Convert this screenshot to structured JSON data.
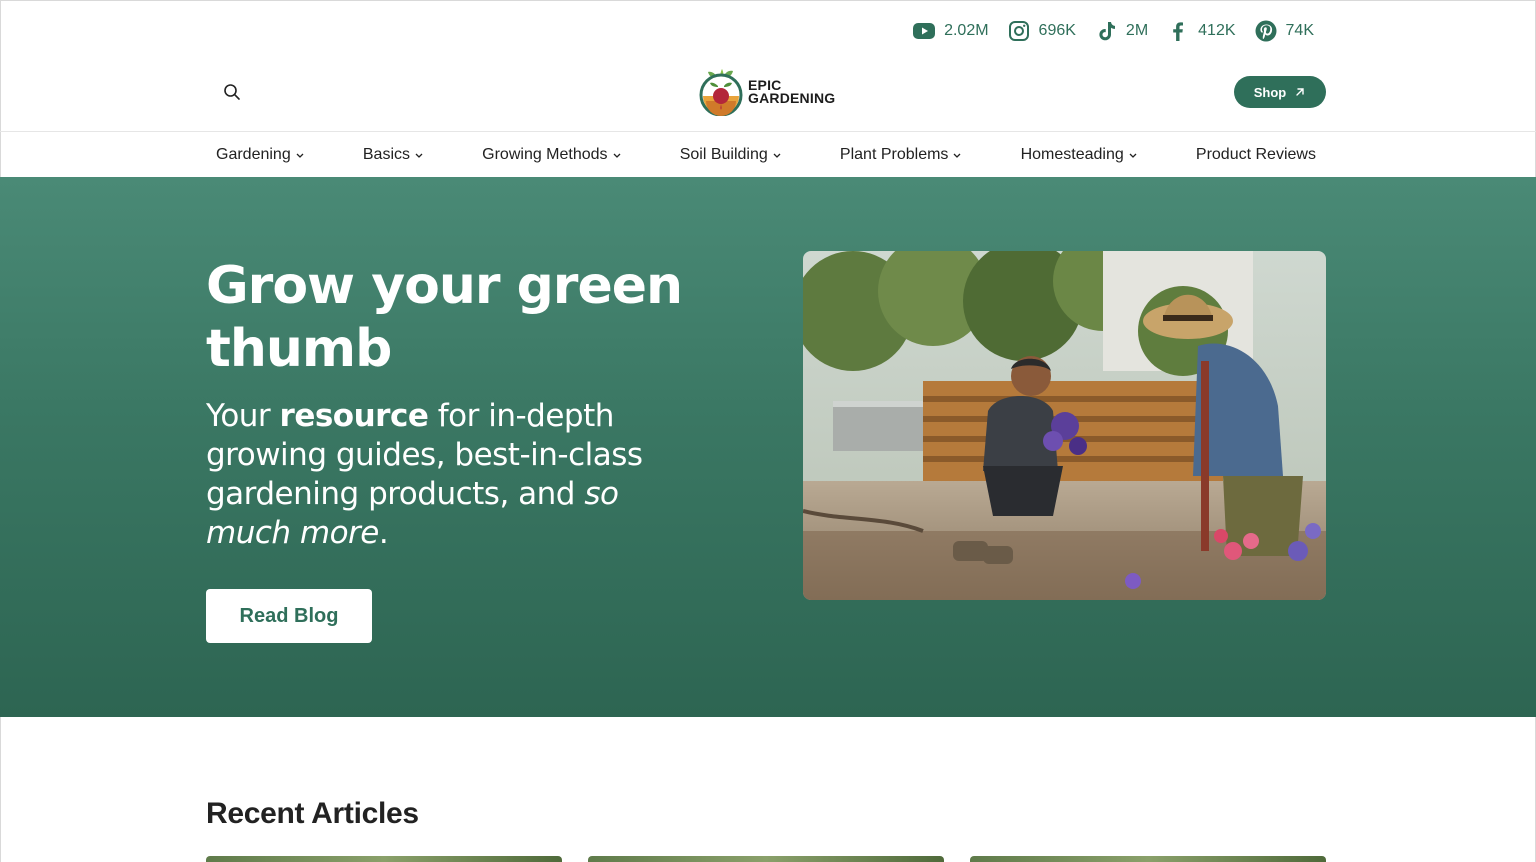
{
  "social": [
    {
      "icon": "youtube-icon",
      "count": "2.02M"
    },
    {
      "icon": "instagram-icon",
      "count": "696K"
    },
    {
      "icon": "tiktok-icon",
      "count": "2M"
    },
    {
      "icon": "facebook-icon",
      "count": "412K"
    },
    {
      "icon": "pinterest-icon",
      "count": "74K"
    }
  ],
  "header": {
    "logo_line1": "EPIC",
    "logo_line2": "GARDENING",
    "shop_label": "Shop"
  },
  "nav": {
    "items": [
      {
        "label": "Gardening"
      },
      {
        "label": "Basics"
      },
      {
        "label": "Growing Methods"
      },
      {
        "label": "Soil Building"
      },
      {
        "label": "Plant Problems"
      },
      {
        "label": "Homesteading"
      },
      {
        "label": "Product Reviews"
      }
    ]
  },
  "hero": {
    "title": "Grow your green thumb",
    "sub_pre": "Your ",
    "sub_bold": "resource",
    "sub_mid": " for in-depth growing guides, best-in-class gardening products, and ",
    "sub_italic": "so much more",
    "sub_end": ".",
    "cta_label": "Read Blog"
  },
  "recent": {
    "title": "Recent Articles"
  },
  "colors": {
    "brand_green": "#2f6f5a",
    "hero_top": "#4a8a76",
    "hero_bottom": "#2d6552"
  }
}
